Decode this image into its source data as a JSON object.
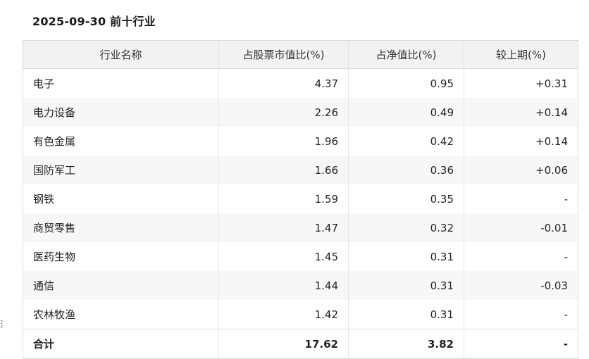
{
  "title": "2025-09-30 前十行业",
  "side_mark": "注",
  "columns": {
    "industry": "行业名称",
    "stock_ratio": "占股票市值比(%)",
    "nav_ratio": "占净值比(%)",
    "change": "较上期(%)"
  },
  "rows": [
    {
      "industry": "电子",
      "stock_ratio": "4.37",
      "nav_ratio": "0.95",
      "change": "+0.31",
      "trend": "pos"
    },
    {
      "industry": "电力设备",
      "stock_ratio": "2.26",
      "nav_ratio": "0.49",
      "change": "+0.14",
      "trend": "pos"
    },
    {
      "industry": "有色金属",
      "stock_ratio": "1.96",
      "nav_ratio": "0.42",
      "change": "+0.14",
      "trend": "pos"
    },
    {
      "industry": "国防军工",
      "stock_ratio": "1.66",
      "nav_ratio": "0.36",
      "change": "+0.06",
      "trend": "pos"
    },
    {
      "industry": "钢铁",
      "stock_ratio": "1.59",
      "nav_ratio": "0.35",
      "change": "-",
      "trend": "flat"
    },
    {
      "industry": "商贸零售",
      "stock_ratio": "1.47",
      "nav_ratio": "0.32",
      "change": "-0.01",
      "trend": "neg"
    },
    {
      "industry": "医药生物",
      "stock_ratio": "1.45",
      "nav_ratio": "0.31",
      "change": "-",
      "trend": "flat"
    },
    {
      "industry": "通信",
      "stock_ratio": "1.44",
      "nav_ratio": "0.31",
      "change": "-0.03",
      "trend": "neg"
    },
    {
      "industry": "农林牧渔",
      "stock_ratio": "1.42",
      "nav_ratio": "0.31",
      "change": "-",
      "trend": "flat"
    }
  ],
  "total": {
    "industry": "合计",
    "stock_ratio": "17.62",
    "nav_ratio": "3.82",
    "change": "-"
  },
  "colors": {
    "positive": "#e5383b",
    "negative": "#2f9e44",
    "header_bg": "#f2f2f2",
    "stripe_bg": "#f7f7f7"
  }
}
